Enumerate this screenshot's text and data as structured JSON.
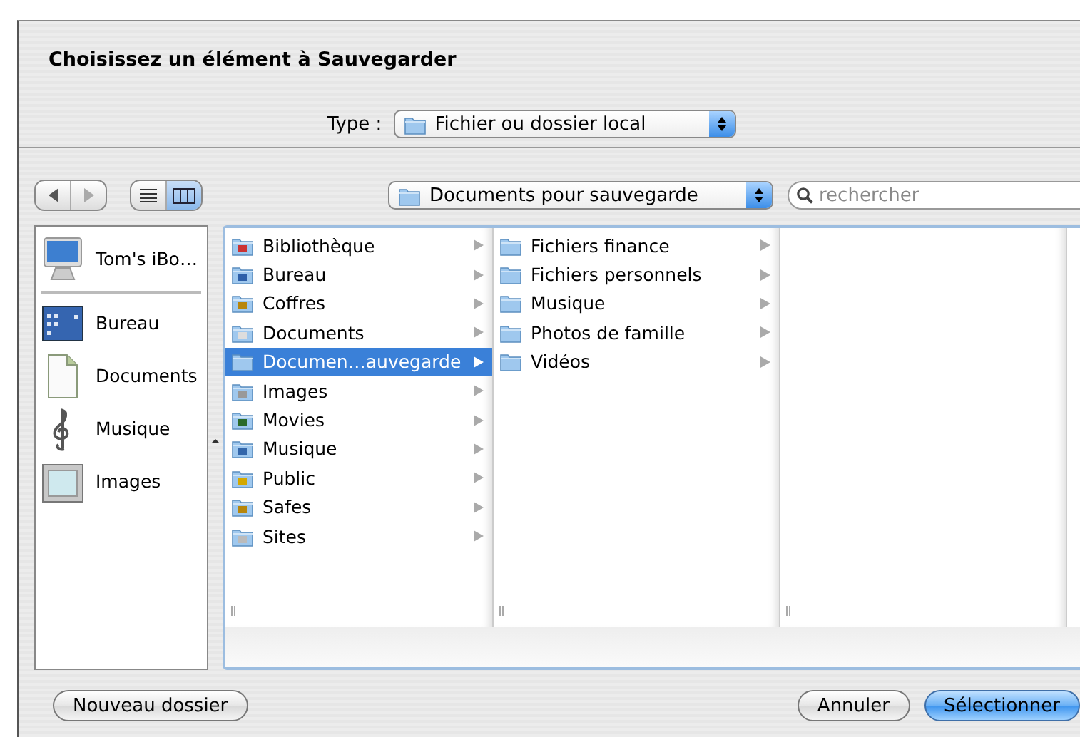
{
  "sheet": {
    "title": "Choisissez un élément à Sauvegarder"
  },
  "type_selector": {
    "label": "Type :",
    "value": "Fichier ou dossier local"
  },
  "toolbar": {
    "view_modes": [
      {
        "kind": "list",
        "selected": false
      },
      {
        "kind": "columns",
        "selected": true
      }
    ],
    "location": "Documents pour sauvegarde",
    "search": {
      "placeholder": "rechercher"
    }
  },
  "sidebar": {
    "devices": [
      {
        "label": "Tom's iBo…",
        "kind": "computer"
      }
    ],
    "places": [
      {
        "label": "Bureau",
        "kind": "desktop"
      },
      {
        "label": "Documents",
        "kind": "document"
      },
      {
        "label": "Musique",
        "kind": "music"
      },
      {
        "label": "Images",
        "kind": "picture"
      }
    ]
  },
  "columns": [
    {
      "items": [
        {
          "label": "Bibliothèque",
          "kind": "library",
          "selected": false
        },
        {
          "label": "Bureau",
          "kind": "desktop",
          "selected": false
        },
        {
          "label": "Coffres",
          "kind": "safe",
          "selected": false
        },
        {
          "label": "Documents",
          "kind": "documents",
          "selected": false
        },
        {
          "label": "Documen…auvegarde",
          "kind": "folder",
          "selected": true
        },
        {
          "label": "Images",
          "kind": "pictures",
          "selected": false
        },
        {
          "label": "Movies",
          "kind": "movies",
          "selected": false
        },
        {
          "label": "Musique",
          "kind": "music",
          "selected": false
        },
        {
          "label": "Public",
          "kind": "public",
          "selected": false
        },
        {
          "label": "Safes",
          "kind": "safe",
          "selected": false
        },
        {
          "label": "Sites",
          "kind": "sites",
          "selected": false
        }
      ]
    },
    {
      "items": [
        {
          "label": "Fichiers finance",
          "kind": "folder",
          "selected": false
        },
        {
          "label": "Fichiers personnels",
          "kind": "folder",
          "selected": false
        },
        {
          "label": "Musique",
          "kind": "folder",
          "selected": false
        },
        {
          "label": "Photos de famille",
          "kind": "folder",
          "selected": false
        },
        {
          "label": "Vidéos",
          "kind": "folder",
          "selected": false
        }
      ]
    }
  ],
  "buttons": [
    {
      "label": "Nouveau dossier",
      "default": false,
      "kind": "extra"
    },
    {
      "label": "Annuler",
      "default": false,
      "kind": "action"
    },
    {
      "label": "Sélectionner",
      "default": true,
      "kind": "action"
    }
  ]
}
